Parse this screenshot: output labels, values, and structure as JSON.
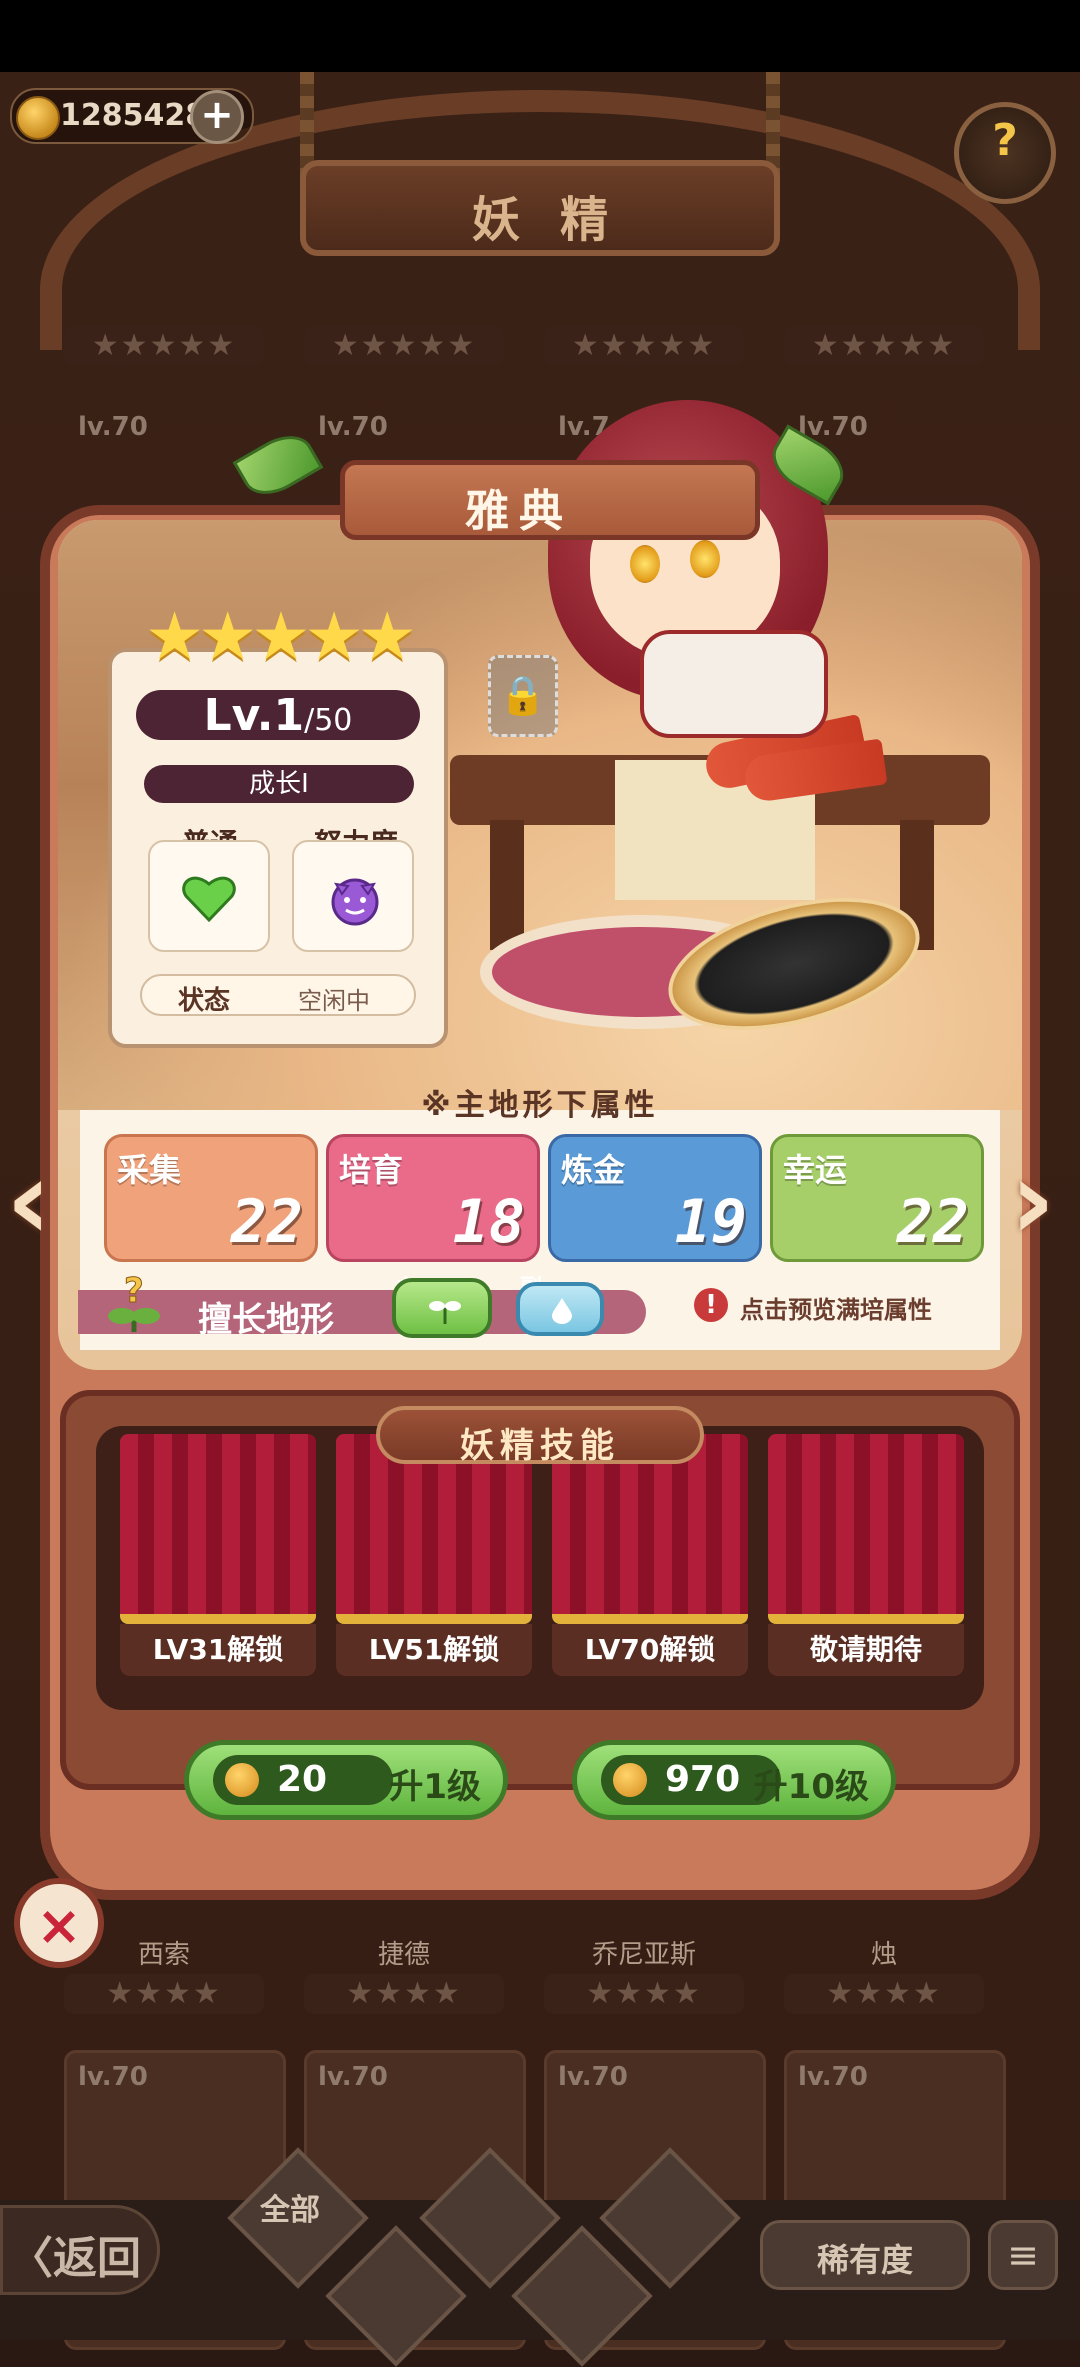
{
  "top": {
    "currency": "12854286",
    "plus_label": "+",
    "help_label": "?",
    "title": "妖精"
  },
  "background_grid": {
    "row1_stars": [
      "★★★★★",
      "★★★★★",
      "★★★★★",
      "★★★★★"
    ],
    "row1_levels": [
      "lv.70",
      "lv.70",
      "lv.7",
      "lv.70"
    ],
    "row2_names": [
      "西索",
      "捷德",
      "乔尼亚斯",
      "烛"
    ],
    "row2_stars": [
      "★★★★",
      "★★★★",
      "★★★★",
      "★★★★"
    ],
    "row3_levels": [
      "lv.70",
      "lv.70",
      "lv.70",
      "lv.70"
    ]
  },
  "sprite": {
    "name": "雅典",
    "stars": "★★★★★",
    "star_count": 5,
    "level_current": "Lv.1",
    "level_max": "/50",
    "growth": "成长I",
    "normal_label": "普通",
    "effort_label": "努力度",
    "status_key": "状态",
    "status_value": "空闲中",
    "lock_icon": "🔒"
  },
  "properties": {
    "heading": "※主地形下属性",
    "items": [
      {
        "label": "采集",
        "value": "22",
        "color": "#f0a27a"
      },
      {
        "label": "培育",
        "value": "18",
        "color": "#ea6a8a"
      },
      {
        "label": "炼金",
        "value": "19",
        "color": "#5a9ad6"
      },
      {
        "label": "幸运",
        "value": "22",
        "color": "#a6cf6a"
      }
    ],
    "terrain_label": "擅长地形",
    "terrain_main": "主",
    "terrain_sub": "副",
    "preview_hint": "点击预览满培属性",
    "alert_symbol": "!",
    "nav_prev": "‹",
    "nav_next": "›"
  },
  "skills": {
    "title": "妖精技能",
    "slots": [
      "LV31解锁",
      "LV51解锁",
      "LV70解锁",
      "敬请期待"
    ]
  },
  "upgrade": {
    "one": {
      "cost": "20",
      "label": "升1级"
    },
    "ten": {
      "cost": "970",
      "label": "升10级"
    }
  },
  "close_label": "×",
  "bottom": {
    "back": "〈返回",
    "filter_all": "全部",
    "rarity": "稀有度",
    "sort": "≡"
  }
}
